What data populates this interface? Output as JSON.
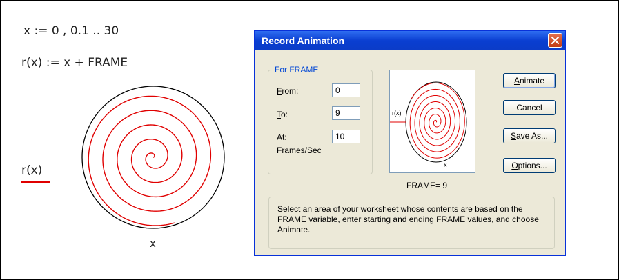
{
  "worksheet": {
    "range_definition": "x := 0 , 0.1 .. 30",
    "function_definition": "r(x) := x + FRAME",
    "plot": {
      "legend_label": "r(x)",
      "x_axis_label": "x",
      "series_color": "#e00000"
    }
  },
  "dialog": {
    "title": "Record Animation",
    "group_title": "For FRAME",
    "from_label_accel": "F",
    "from_label_rest": "rom:",
    "from_value": "0",
    "to_label_accel": "T",
    "to_label_rest": "o:",
    "to_value": "9",
    "at_label_accel": "A",
    "at_label_rest": "t:",
    "at_value": "10",
    "frames_per_sec": "Frames/Sec",
    "preview": {
      "legend_label": "r(x)",
      "x_axis_label": "x"
    },
    "frame_readout": "FRAME=  9",
    "buttons": {
      "animate_accel": "A",
      "animate_rest": "nimate",
      "cancel": "Cancel",
      "save_accel": "S",
      "save_rest": "ave As...",
      "options_accel": "O",
      "options_rest": "ptions..."
    },
    "instructions": "Select an area of your worksheet whose contents are based on the FRAME variable, enter starting and ending FRAME values, and choose Animate."
  }
}
